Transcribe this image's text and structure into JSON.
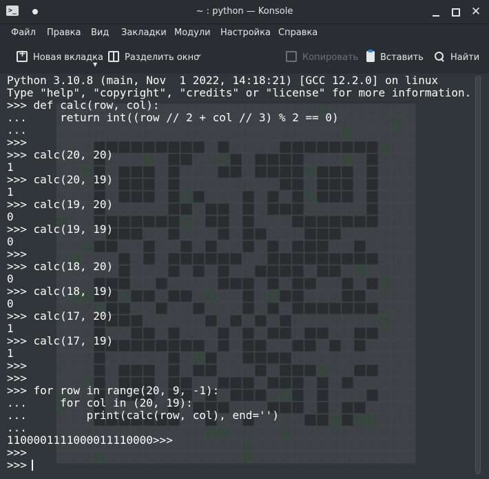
{
  "window": {
    "title": "~ : python — Konsole",
    "colors": {
      "background": "#232629",
      "terminal": "#31363b",
      "text": "#fcfcfc",
      "accent": "#2a7fd4"
    }
  },
  "titlebar_icons": [
    "konsole-app-icon",
    "pin-icon",
    "minimize-icon",
    "maximize-icon",
    "close-icon"
  ],
  "menu": [
    "Файл",
    "Правка",
    "Вид",
    "Закладки",
    "Модули",
    "Настройка",
    "Справка"
  ],
  "toolbar": {
    "new_tab": "Новая вкладка",
    "split": "Разделить окно",
    "copy": "Копировать",
    "paste": "Вставить",
    "find": "Найти"
  },
  "terminal": {
    "lines": [
      "Python 3.10.8 (main, Nov  1 2022, 14:18:21) [GCC 12.2.0] on linux",
      "Type \"help\", \"copyright\", \"credits\" or \"license\" for more information.",
      ">>> def calc(row, col):",
      "...     return int((row // 2 + col // 3) % 2 == 0)",
      "...",
      ">>>",
      ">>> calc(20, 20)",
      "1",
      ">>> calc(20, 19)",
      "1",
      ">>> calc(19, 20)",
      "0",
      ">>> calc(19, 19)",
      "0",
      ">>>",
      ">>> calc(18, 20)",
      "0",
      ">>> calc(18, 19)",
      "0",
      ">>> calc(17, 20)",
      "1",
      ">>> calc(17, 19)",
      "1",
      ">>>",
      ">>>",
      ">>> for row in range(20, 9, -1):",
      "...     for col in (20, 19):",
      "...         print(calc(row, col), end='')",
      "...",
      "1100001111000011110000>>>",
      ">>>",
      ">>> "
    ]
  }
}
